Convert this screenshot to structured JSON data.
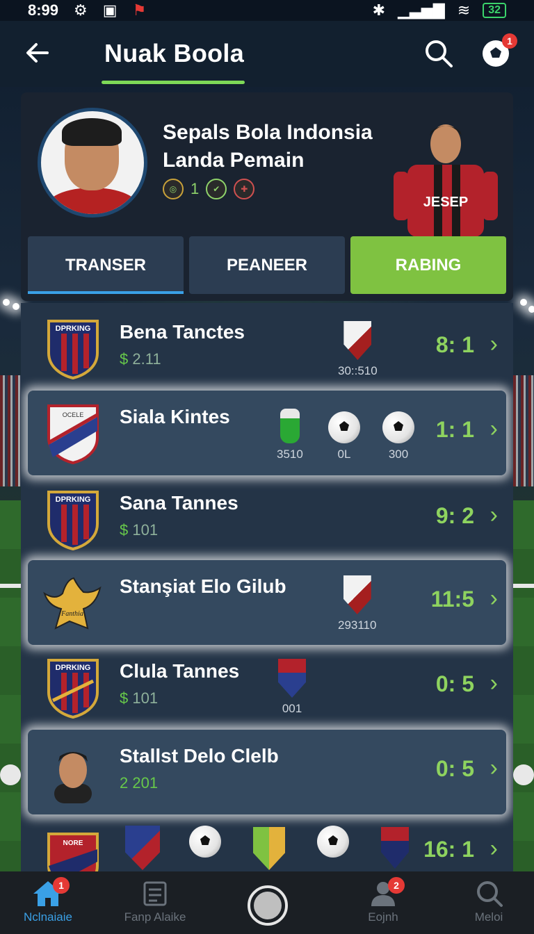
{
  "status_bar": {
    "time": "8:99",
    "battery": "32"
  },
  "header": {
    "title": "Nuak Boola",
    "notification_count": "1"
  },
  "profile": {
    "title_line1": "Sepals Bola Indonsia",
    "title_line2": "Landa Pemain",
    "badge_count": "1",
    "jersey_text": "JESEP"
  },
  "tabs": [
    {
      "label": "TRANSER"
    },
    {
      "label": "PEANEER"
    },
    {
      "label": "RABING"
    }
  ],
  "rows": [
    {
      "name": "Bena Tanctes",
      "currency": "$",
      "price": "2.11",
      "extras": [
        "30::510"
      ],
      "score": "8: 1",
      "crest_text": "DPRKING"
    },
    {
      "name": "Siala Kintes",
      "extras": [
        "3510",
        "0L",
        "300"
      ],
      "score": "1: 1",
      "crest_text": "OCELE"
    },
    {
      "name": "Sana Tannes",
      "currency": "$",
      "price": "101",
      "score": "9: 2",
      "crest_text": "DPRKING"
    },
    {
      "name": "Stanşiat Elo Gilub",
      "extras": [
        "293110"
      ],
      "score": "11:5",
      "crest_text": "Fanthia"
    },
    {
      "name": "Clula Tannes",
      "currency": "$",
      "price": "101",
      "extras": [
        "001"
      ],
      "score": "0: 5",
      "crest_text": "DPRKING"
    },
    {
      "name": "Stallst Delo Clelb",
      "price_plain": "2 201",
      "score": "0: 5"
    },
    {
      "score": "16: 1",
      "crest_text": "NORE"
    }
  ],
  "bottom_nav": {
    "items": [
      {
        "label": "Nclnaiaie",
        "badge": "1",
        "icon": "home-icon"
      },
      {
        "label": "Fanp Alaike",
        "icon": "fan-icon"
      },
      {
        "label": "Eojnh",
        "badge": "2",
        "icon": "person-icon"
      },
      {
        "label": "Meloi",
        "icon": "search-icon"
      }
    ]
  },
  "colors": {
    "accent_green": "#7fc241",
    "score_green": "#8ed35f",
    "tab_blue": "#3aa0e6",
    "badge_red": "#e53935"
  }
}
